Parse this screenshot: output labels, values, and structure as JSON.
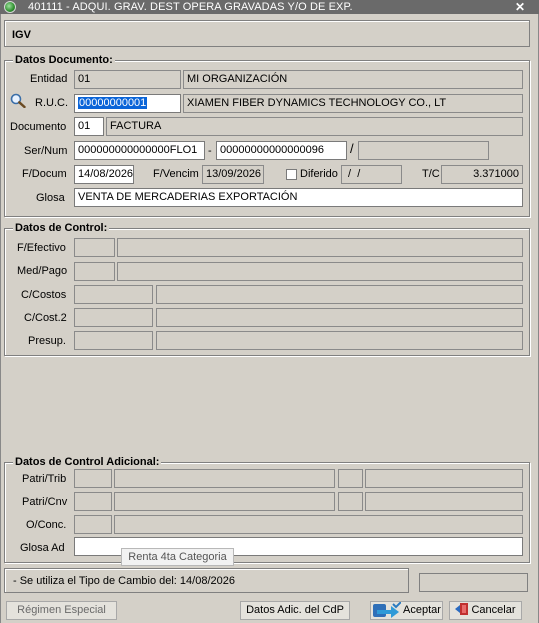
{
  "window": {
    "title": "401111 - ADQUI. GRAV. DEST OPERA GRAVADAS Y/O DE EXP.",
    "close": "✕"
  },
  "header": {
    "label": "IGV"
  },
  "datos_documento": {
    "legend": "Datos Documento:",
    "entidad": {
      "label": "Entidad",
      "code": "01",
      "name": "MI ORGANIZACIÓN"
    },
    "ruc": {
      "label": "R.U.C.",
      "value": "00000000001",
      "name": "XIAMEN FIBER DYNAMICS TECHNOLOGY CO., LT"
    },
    "documento": {
      "label": "Documento",
      "code": "01",
      "name": "FACTURA"
    },
    "ser_num": {
      "label": "Ser/Num",
      "serie": "000000000000000FLO1",
      "sep1": "-",
      "numero": "00000000000000096",
      "sep2": "/",
      "extra": ""
    },
    "f_docum": {
      "label": "F/Docum",
      "value": "14/08/2026"
    },
    "f_vencim": {
      "label": "F/Vencim",
      "value": "13/09/2026"
    },
    "diferido": {
      "label": "Diferido",
      "value": " /  /",
      "checked": false
    },
    "tc": {
      "label": "T/C",
      "value": "3.371000"
    },
    "glosa": {
      "label": "Glosa",
      "value": "VENTA DE MERCADERIAS EXPORTACIÓN"
    }
  },
  "datos_control": {
    "legend": "Datos de Control:",
    "f_efectivo": "F/Efectivo",
    "med_pago": "Med/Pago",
    "c_costos": "C/Costos",
    "c_cost2": "C/Cost.2",
    "presup": "Presup."
  },
  "datos_control_adicional": {
    "legend": "Datos de Control Adicional:",
    "patri_trib": "Patri/Trib",
    "patri_cnv": "Patri/Cnv",
    "o_conc": "O/Conc.",
    "glosa_ad": "Glosa Ad",
    "glosa_ad_value": ""
  },
  "tooltip": "Renta 4ta Categoria",
  "status": {
    "text": "- Se utiliza el Tipo de Cambio del: 14/08/2026"
  },
  "buttons": {
    "regimen": "Régimen Especial",
    "datos_adic": "Datos Adic. del CdP",
    "aceptar": "Aceptar",
    "cancelar": "Cancelar"
  },
  "icons": {
    "window": "app-globe-icon",
    "search": "magnifier-icon",
    "accept": "accept-arrow-icon",
    "cancel": "exit-door-icon"
  }
}
